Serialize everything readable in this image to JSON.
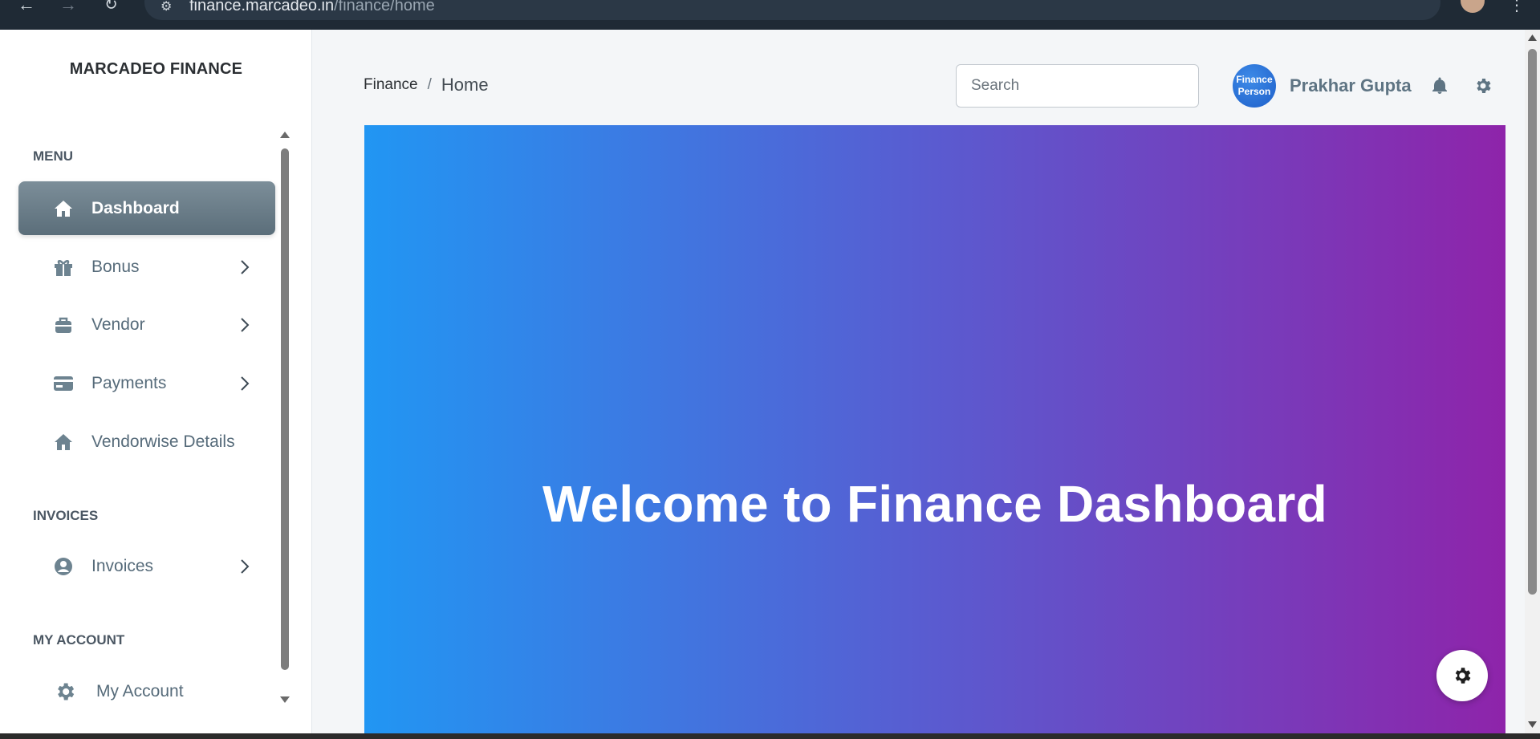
{
  "browser": {
    "url_host": "finance.marcadeo.in",
    "url_path": "/finance/home"
  },
  "sidebar": {
    "brand": "MARCADEO FINANCE",
    "sections": {
      "menu": "MENU",
      "invoices": "INVOICES",
      "my_account": "MY ACCOUNT"
    },
    "items": [
      {
        "label": "Dashboard",
        "icon": "home-icon",
        "active": true
      },
      {
        "label": "Bonus",
        "icon": "gift-icon",
        "has_children": true
      },
      {
        "label": "Vendor",
        "icon": "briefcase-icon",
        "has_children": true
      },
      {
        "label": "Payments",
        "icon": "credit-card-icon",
        "has_children": true
      },
      {
        "label": "Vendorwise Details",
        "icon": "home-icon"
      },
      {
        "label": "Invoices",
        "icon": "user-circle-icon",
        "has_children": true
      },
      {
        "label": "My Account",
        "icon": "gear-icon"
      }
    ]
  },
  "header": {
    "breadcrumb": {
      "parent": "Finance",
      "separator": "/",
      "current": "Home"
    },
    "search": {
      "placeholder": "Search"
    },
    "avatar_text": "Finance Person",
    "username": "Prakhar Gupta"
  },
  "hero": {
    "title": "Welcome to Finance Dashboard"
  },
  "colors": {
    "hero_gradient_start": "#2196f3",
    "hero_gradient_end": "#8e24aa",
    "active_nav": "#6b7f8b",
    "nav_text": "#566b7a"
  }
}
